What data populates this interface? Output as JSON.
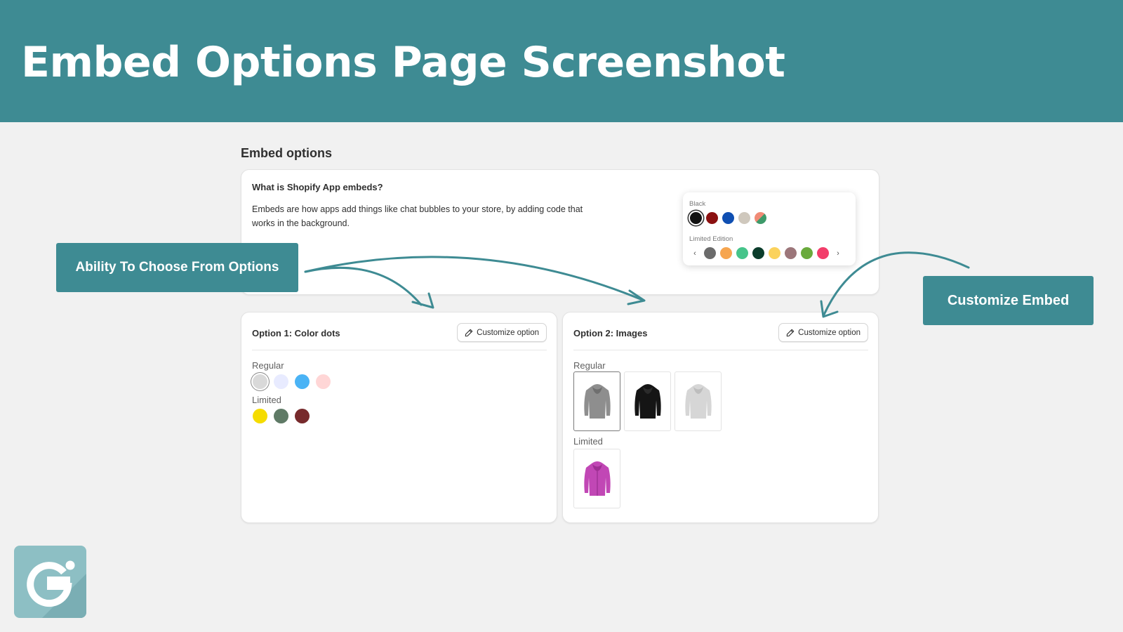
{
  "banner": {
    "title": "Embed Options Page Screenshot"
  },
  "section": {
    "heading": "Embed options"
  },
  "info_card": {
    "title": "What is Shopify App embeds?",
    "text": "Embeds are how apps add things like chat bubbles to your store, by adding code that works in the background."
  },
  "popup": {
    "group1_label": "Black",
    "group1_colors": [
      "#111111",
      "#8b1010",
      "#0f4fb2",
      "#cfc8bd",
      "split-green-salmon"
    ],
    "group2_label": "Limited Edition",
    "group2_colors": [
      "#6b6b6b",
      "#f6a54f",
      "#46c48a",
      "#0b3d2c",
      "#fbd25c",
      "#9c767a",
      "#6aaa3c",
      "#f23d6a"
    ],
    "prev_icon": "chevron-left-icon",
    "next_icon": "chevron-right-icon"
  },
  "option1": {
    "title": "Option 1: Color dots",
    "button_label": "Customize option",
    "regular_label": "Regular",
    "regular_colors": [
      "#d9d9d9",
      "#e8ebff",
      "#4ab3f5",
      "#ffd6d6"
    ],
    "limited_label": "Limited",
    "limited_colors": [
      "#f5dc00",
      "#5f7a66",
      "#772a2c"
    ]
  },
  "option2": {
    "title": "Option 2: Images",
    "button_label": "Customize option",
    "regular_label": "Regular",
    "regular_images": [
      "grey-hoodie",
      "black-hoodie",
      "light-grey-hoodie"
    ],
    "limited_label": "Limited",
    "limited_images": [
      "pink-hoodie"
    ]
  },
  "callouts": {
    "left": "Ability To Choose From Options",
    "right": "Customize Embed"
  },
  "colors": {
    "accent": "#3e8b93",
    "logo": "#8dbfc4"
  }
}
